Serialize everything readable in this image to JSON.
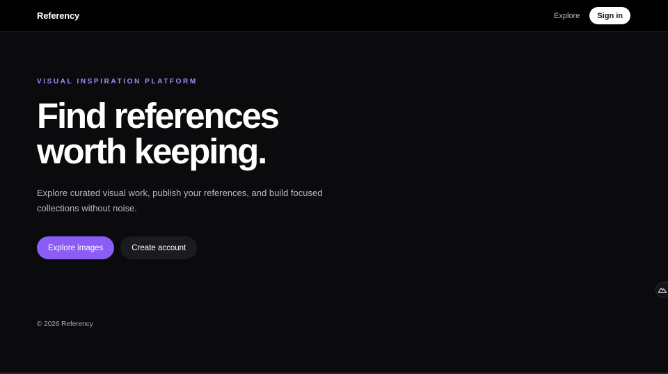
{
  "header": {
    "brand": "Referency",
    "nav": {
      "explore_label": "Explore",
      "signin_label": "Sign in"
    }
  },
  "hero": {
    "eyebrow": "VISUAL INSPIRATION PLATFORM",
    "headline": "Find references worth keeping.",
    "subtext": "Explore curated visual work, publish your references, and build focused collections without noise.",
    "primary_cta": "Explore images",
    "secondary_cta": "Create account"
  },
  "footer": {
    "copyright": "© 2026 Referency"
  },
  "icons": {
    "corner_badge": "mountain-logo-icon"
  },
  "colors": {
    "background": "#0b0b0d",
    "header": "#000000",
    "accent": "#8b5cf6",
    "eyebrow": "#a78bfa",
    "secondary_button": "#1a1b20"
  }
}
